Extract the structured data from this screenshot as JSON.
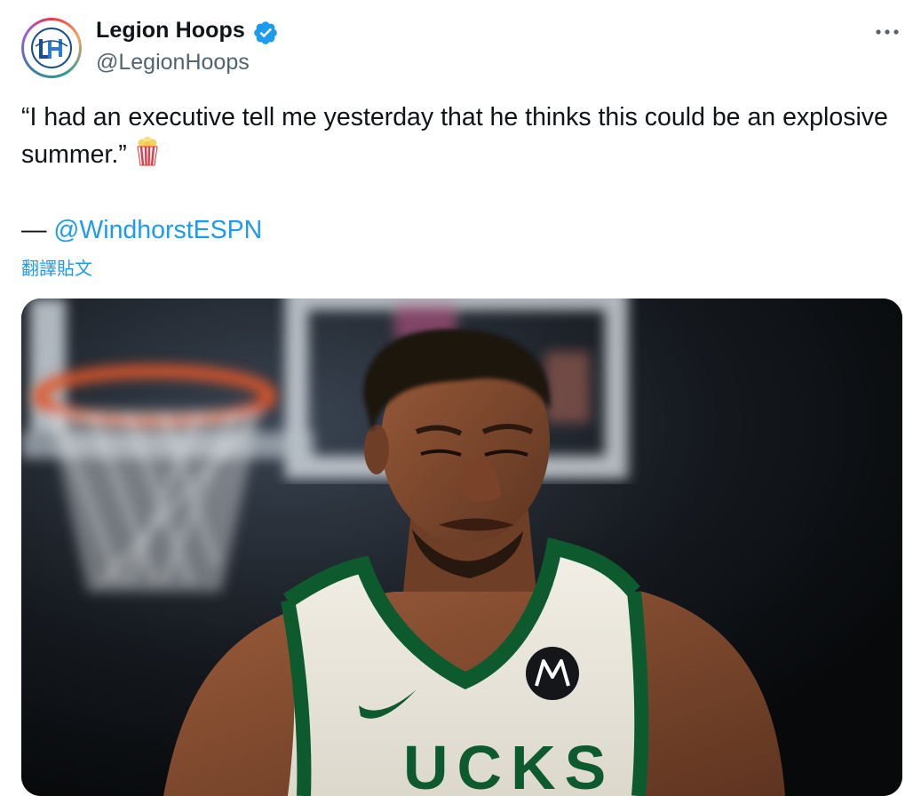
{
  "account": {
    "display_name": "Legion Hoops",
    "handle": "@LegionHoops",
    "avatar_monogram": "LH",
    "verified": true
  },
  "tweet": {
    "text": "“I had an executive tell me yesterday that he thinks this could be an explosive summer.”",
    "emoji": "popcorn-icon",
    "attribution_prefix": "— ",
    "mention": "@WindhorstESPN",
    "translate_label": "翻譯貼文"
  },
  "media": {
    "jersey_lettering": "UCKS"
  },
  "colors": {
    "link": "#1d9bf0",
    "text": "#0f1419",
    "muted": "#536471",
    "verified": "#1d9bf0",
    "jersey_trim": "#0e5a2f"
  }
}
